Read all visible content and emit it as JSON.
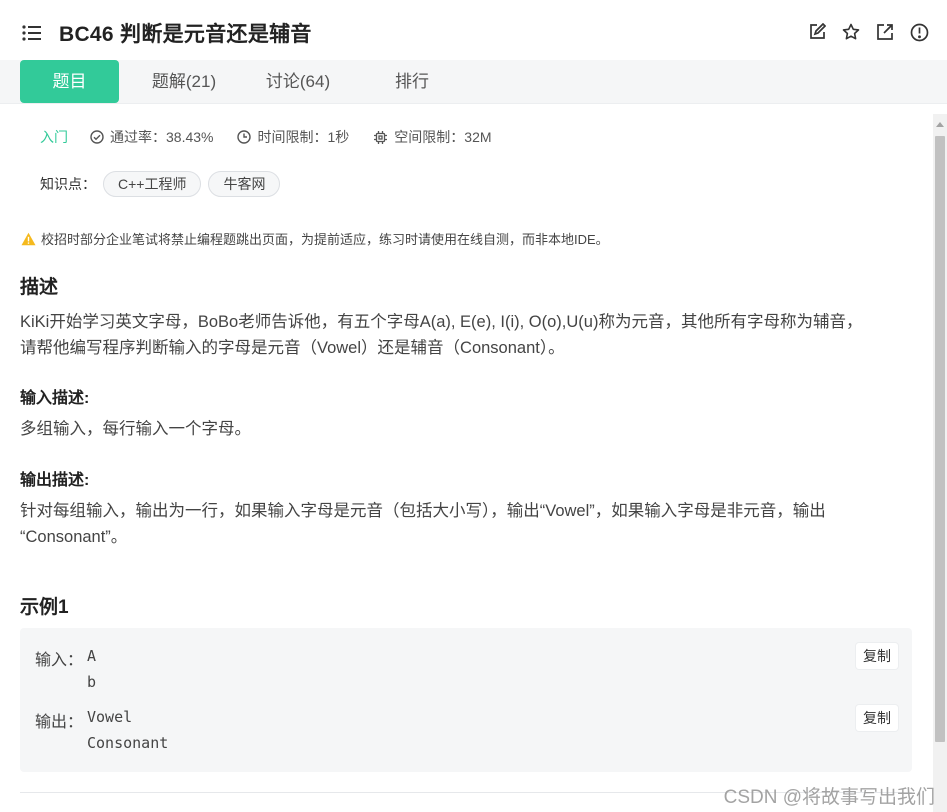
{
  "header": {
    "title": "BC46  判断是元音还是辅音",
    "menu_icon": "list-icon",
    "actions": [
      "edit-icon",
      "star-icon",
      "external-link-icon",
      "info-icon"
    ]
  },
  "tabs": [
    {
      "label": "题目",
      "active": true
    },
    {
      "label": "题解(21)",
      "active": false
    },
    {
      "label": "讨论(64)",
      "active": false
    },
    {
      "label": "排行",
      "active": false
    }
  ],
  "meta": {
    "level": "入门",
    "pass_rate": "通过率：38.43%",
    "time_limit": "时间限制：1秒",
    "space_limit": "空间限制：32M"
  },
  "knowledge": {
    "label": "知识点：",
    "tags": [
      "C++工程师",
      "牛客网"
    ]
  },
  "notice": "校招时部分企业笔试将禁止编程题跳出页面，为提前适应，练习时请使用在线自测，而非本地IDE。",
  "description": {
    "title": "描述",
    "line1": "KiKi开始学习英文字母，BoBo老师告诉他，有五个字母A(a), E(e), I(i), O(o),U(u)称为元音，其他所有字母称为辅音，",
    "line2": "请帮他编写程序判断输入的字母是元音（Vowel）还是辅音（Consonant）。"
  },
  "input_desc": {
    "title": "输入描述:",
    "text": "多组输入，每行输入一个字母。"
  },
  "output_desc": {
    "title": "输出描述:",
    "line1": "针对每组输入，输出为一行，如果输入字母是元音（包括大小写），输出“Vowel”，如果输入字母是非元音，输出",
    "line2": "“Consonant”。"
  },
  "example": {
    "title": "示例1",
    "input_label": "输入：",
    "input_code": "A\nb",
    "output_label": "输出：",
    "output_code": "Vowel\nConsonant",
    "copy_label": "复制"
  },
  "watermark": "CSDN @将故事写出我们",
  "colors": {
    "accent": "#32ca99",
    "warning": "#f5b91d"
  }
}
